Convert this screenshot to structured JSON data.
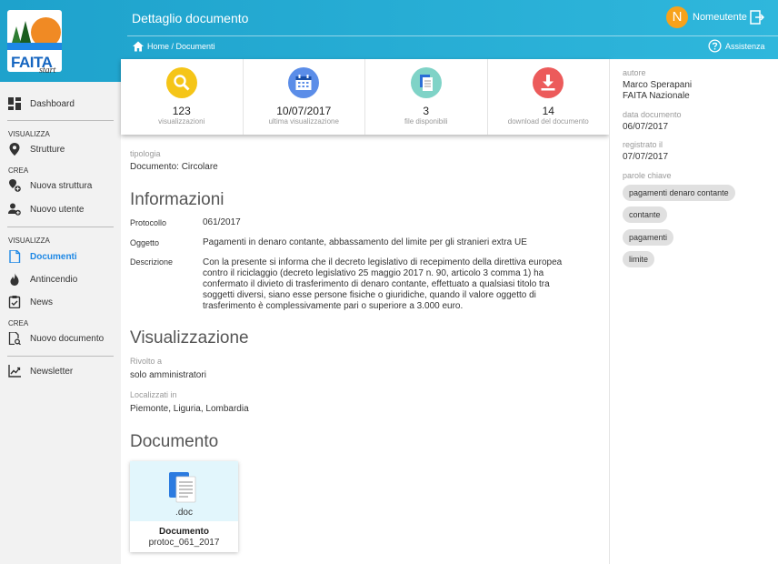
{
  "header": {
    "logo_text": "FAITA",
    "logo_sub": "start",
    "title": "Dettaglio documento",
    "user_initial": "N",
    "user_name": "Nomeutente",
    "breadcrumb": "Home / Documenti",
    "help_label": "Assistenza"
  },
  "sidebar": {
    "dashboard": "Dashboard",
    "section_visualizza_1": "VISUALIZZA",
    "strutture": "Strutture",
    "section_crea_1": "CREA",
    "nuova_struttura": "Nuova struttura",
    "nuovo_utente": "Nuovo utente",
    "section_visualizza_2": "VISUALIZZA",
    "documenti": "Documenti",
    "antincendio": "Antincendio",
    "news": "News",
    "section_crea_2": "CREA",
    "nuovo_documento": "Nuovo documento",
    "newsletter": "Newsletter"
  },
  "stats": [
    {
      "value": "123",
      "label": "visualizzazioni",
      "color": "#f5c518",
      "icon": "search-icon"
    },
    {
      "value": "10/07/2017",
      "label": "ultima visualizzazione",
      "color": "#5b8de8",
      "icon": "calendar-icon"
    },
    {
      "value": "3",
      "label": "file disponibili",
      "color": "#7fd3c7",
      "icon": "files-icon"
    },
    {
      "value": "14",
      "label": "download del documento",
      "color": "#ec5b5b",
      "icon": "download-icon"
    }
  ],
  "main": {
    "tipologia_label": "tipologia",
    "tipologia_value": "Documento: Circolare",
    "info_title": "Informazioni",
    "protocollo_label": "Protocollo",
    "protocollo_value": "061/2017",
    "oggetto_label": "Oggetto",
    "oggetto_value": "Pagamenti in denaro contante, abbassamento del limite per gli stranieri extra UE",
    "descrizione_label": "Descrizione",
    "descrizione_lines": [
      "Con la presente si informa che il decreto legislativo di recepimento della direttiva europea",
      "contro il riciclaggio (decreto legislativo 25 maggio 2017 n. 90, articolo 3 comma 1) ha",
      "confermato il divieto di trasferimento di denaro contante, effettuato a qualsiasi titolo tra",
      "soggetti diversi, siano esse persone fisiche o giuridiche, quando il valore oggetto di",
      "trasferimento è complessivamente pari o superiore a 3.000 euro."
    ],
    "visual_title": "Visualizzazione",
    "rivolto_label": "Rivolto a",
    "rivolto_value": "solo amministratori",
    "localizzati_label": "Localizzati in",
    "localizzati_value": "Piemonte, Liguria, Lombardia",
    "documento_title": "Documento",
    "doc_card": {
      "ext": ".doc",
      "title": "Documento",
      "filename": "protoc_061_2017"
    }
  },
  "right": {
    "autore_label": "autore",
    "autore_lines": [
      "Marco Sperapani",
      "FAITA Nazionale"
    ],
    "data_label": "data documento",
    "data_value": "06/07/2017",
    "registrato_label": "registrato il",
    "registrato_value": "07/07/2017",
    "parole_label": "parole chiave",
    "tags": [
      "pagamenti denaro contante",
      "contante",
      "pagamenti",
      "limite"
    ]
  }
}
